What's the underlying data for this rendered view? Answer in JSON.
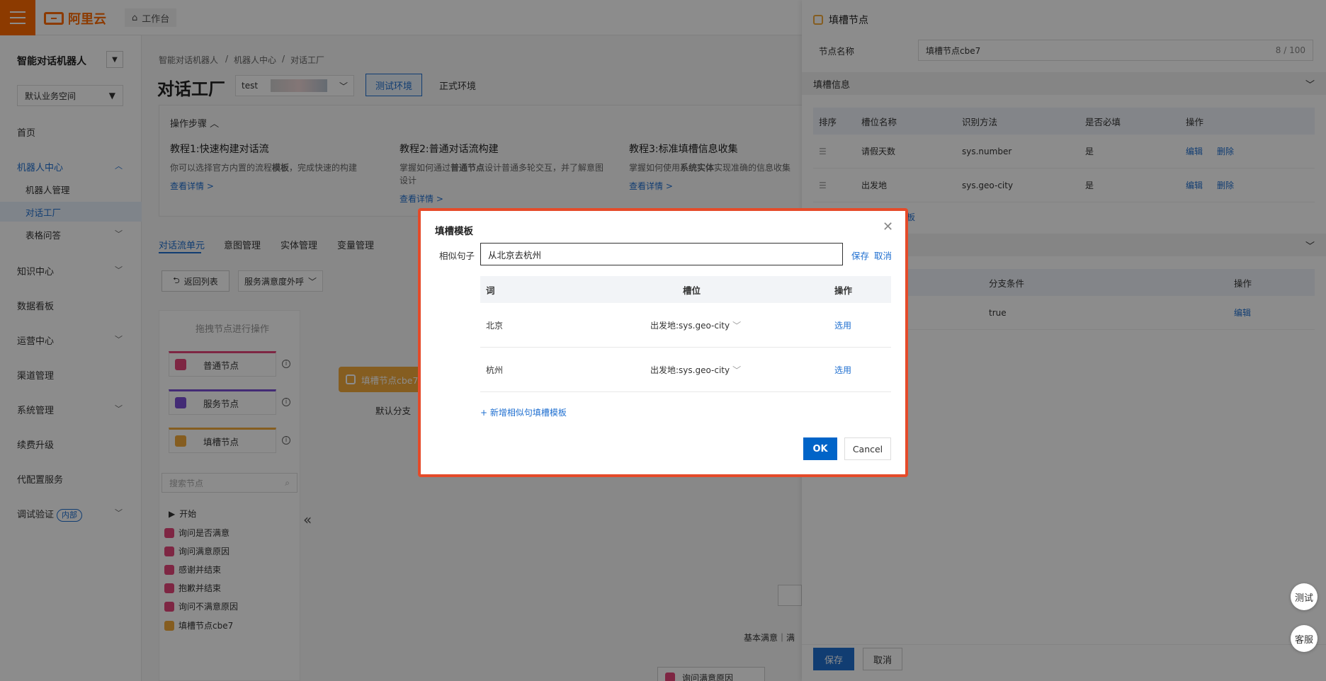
{
  "topbar": {
    "logo_text": "阿里云",
    "workbench_label": "工作台"
  },
  "sidebar": {
    "title": "智能对话机器人",
    "space": "默认业务空间",
    "items": [
      {
        "label": "首页"
      },
      {
        "label": "机器人中心"
      },
      {
        "label": "机器人管理"
      },
      {
        "label": "对话工厂"
      },
      {
        "label": "表格问答"
      },
      {
        "label": "知识中心"
      },
      {
        "label": "数据看板"
      },
      {
        "label": "运营中心"
      },
      {
        "label": "渠道管理"
      },
      {
        "label": "系统管理"
      },
      {
        "label": "续费升级"
      },
      {
        "label": "代配置服务"
      },
      {
        "label": "调试验证"
      }
    ],
    "debug_badge": "内部"
  },
  "main": {
    "breadcrumb": [
      "智能对话机器人",
      "/",
      "机器人中心",
      "/",
      "对话工厂"
    ],
    "page_title": "对话工厂",
    "env_select_value": "test",
    "test_env": "测试环境",
    "prod_env": "正式环境",
    "steps_title": "操作步骤",
    "tutorials": [
      {
        "title": "教程1:快速构建对话流",
        "desc_a": "你可以选择官方内置的流程",
        "desc_b": "模板",
        "desc_c": "，完成快速的构建",
        "link": "查看详情 >"
      },
      {
        "title": "教程2:普通对话流构建",
        "desc_a": "掌握如何通过",
        "desc_b": "普通节点",
        "desc_c": "设计普通多轮交互，并了解意图设计",
        "link": "查看详情 >"
      },
      {
        "title": "教程3:标准填槽信息收集",
        "desc_a": "掌握如何使用",
        "desc_b": "系统实体",
        "desc_c": "实现准确的信息收集",
        "link": "查看详情 >"
      }
    ],
    "tabs": [
      "对话流单元",
      "意图管理",
      "实体管理",
      "变量管理"
    ],
    "back_button": "返回列表",
    "flow_select": "服务满意度外呼",
    "drag_hint": "拖拽节点进行操作",
    "node_tiles": [
      "普通节点",
      "服务节点",
      "填槽节点"
    ],
    "search_placeholder": "搜索节点",
    "tree": [
      "开始",
      "询问是否满意",
      "询问满意原因",
      "感谢并结束",
      "抱歉并结束",
      "询问不满意原因",
      "填槽节点cbe7"
    ],
    "canvas_node": "填槽节点cbe7",
    "default_branch": "默认分支",
    "canvas_label": "基本满意｜满",
    "canvas_bottom_node": "询问满意原因"
  },
  "drawer": {
    "title": "填槽节点",
    "name_label": "节点名称",
    "name_value": "填槽节点cbe7",
    "name_count": "8 / 100",
    "slot_section": "填槽信息",
    "slot_headers": [
      "排序",
      "槽位名称",
      "识别方法",
      "是否必填",
      "操作"
    ],
    "slot_rows": [
      {
        "name": "请假天数",
        "method": "sys.number",
        "required": "是",
        "edit": "编辑",
        "delete": "删除"
      },
      {
        "name": "出发地",
        "method": "sys.geo-city",
        "required": "是",
        "edit": "编辑",
        "delete": "删除"
      }
    ],
    "template_link_fragment": "板",
    "branch_headers": [
      "分支条件",
      "操作"
    ],
    "branch_row": {
      "condition": "true",
      "edit": "编辑"
    },
    "save": "保存",
    "cancel": "取消"
  },
  "float_buttons": {
    "test": "测试",
    "service": "客服"
  },
  "modal": {
    "title": "填槽模板",
    "similar_label": "相似句子",
    "similar_value": "从北京去杭州",
    "save": "保存",
    "cancel_inline": "取消",
    "headers": [
      "词",
      "槽位",
      "操作"
    ],
    "rows": [
      {
        "word": "北京",
        "slot": "出发地:sys.geo-city",
        "action": "选用"
      },
      {
        "word": "杭州",
        "slot": "出发地:sys.geo-city",
        "action": "选用"
      }
    ],
    "add_link": "+ 新增相似句填槽模板",
    "ok": "OK",
    "cancel": "Cancel"
  },
  "colors": {
    "brand": "#ff6a00",
    "primary": "#0064c8",
    "highlight_border": "#e54b2a",
    "slot_node": "#f2a93b"
  }
}
